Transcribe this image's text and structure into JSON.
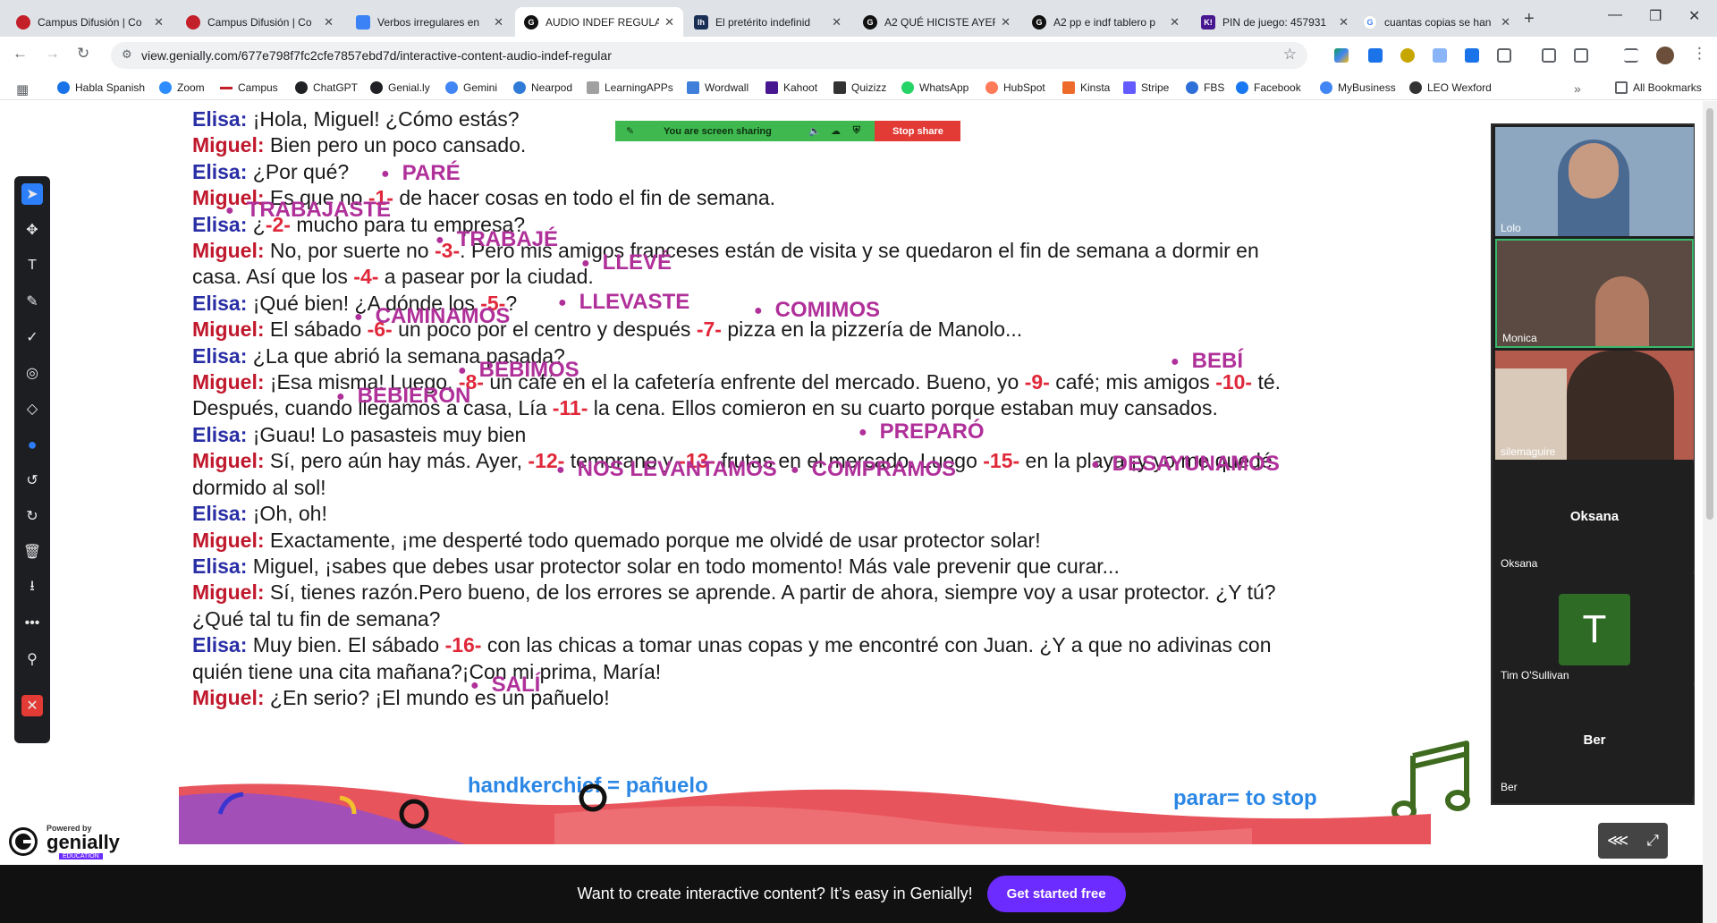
{
  "tabs": [
    {
      "title": "Campus Difusión | Co",
      "fav_color": "#c4202a",
      "fav_text": ""
    },
    {
      "title": "Campus Difusión | Co",
      "fav_color": "#c4202a",
      "fav_text": ""
    },
    {
      "title": "Verbos irregulares en",
      "fav_color": "#3b82f6",
      "fav_text": ""
    },
    {
      "title": "AUDIO INDEF REGULA",
      "fav_color": "#111111",
      "fav_text": "G"
    },
    {
      "title": "El pretérito indefinid",
      "fav_color": "#1a2f55",
      "fav_text": "lh"
    },
    {
      "title": "A2 QUÉ HICISTE AYER",
      "fav_color": "#111111",
      "fav_text": "G"
    },
    {
      "title": "A2 pp e indf tablero p",
      "fav_color": "#111111",
      "fav_text": "G"
    },
    {
      "title": "PIN de juego: 457931",
      "fav_color": "#46178f",
      "fav_text": "K!"
    },
    {
      "title": "cuantas copias se han",
      "fav_color": "#ffffff",
      "fav_text": "G"
    }
  ],
  "url": "view.genially.com/677e798f7fc2cfe7857ebd7d/interactive-content-audio-indef-regular",
  "bookmarks": [
    {
      "label": "Habla Spanish",
      "color": "#1a73e8"
    },
    {
      "label": "Zoom",
      "color": "#2d8cff"
    },
    {
      "label": "Campus",
      "color": "#c4202a"
    },
    {
      "label": "ChatGPT",
      "color": "#202124"
    },
    {
      "label": "Genial.ly",
      "color": "#202124"
    },
    {
      "label": "Gemini",
      "color": "#4285f4"
    },
    {
      "label": "Nearpod",
      "color": "#2f7bd7"
    },
    {
      "label": "LearningAPPs",
      "color": "#a0a0a0"
    },
    {
      "label": "Wordwall",
      "color": "#3f7fd9"
    },
    {
      "label": "Kahoot",
      "color": "#46178f"
    },
    {
      "label": "Quizizz",
      "color": "#333333"
    },
    {
      "label": "WhatsApp",
      "color": "#25d366"
    },
    {
      "label": "HubSpot",
      "color": "#ff7a59"
    },
    {
      "label": "Kinsta",
      "color": "#ee6a2b"
    },
    {
      "label": "Stripe",
      "color": "#635bff"
    },
    {
      "label": "FBS",
      "color": "#2e6fd8"
    },
    {
      "label": "Facebook",
      "color": "#1877f2"
    },
    {
      "label": "MyBusiness",
      "color": "#4285f4"
    },
    {
      "label": "LEO Wexford",
      "color": "#333333"
    }
  ],
  "all_bookmarks": "All Bookmarks",
  "screen_share": {
    "status": "You are screen sharing",
    "stop": "Stop share"
  },
  "dialogue": [
    [
      {
        "t": "spk",
        "c": "elisa",
        "v": "Elisa:"
      },
      {
        "t": "txt",
        "v": " ¡Hola, Miguel! ¿Cómo estás?"
      }
    ],
    [
      {
        "t": "spk",
        "c": "miguel",
        "v": "Miguel:"
      },
      {
        "t": "txt",
        "v": " Bien pero un poco cansado."
      }
    ],
    [
      {
        "t": "spk",
        "c": "elisa",
        "v": "Elisa:"
      },
      {
        "t": "txt",
        "v": " ¿Por qué?"
      }
    ],
    [
      {
        "t": "spk",
        "c": "miguel",
        "v": "Miguel:"
      },
      {
        "t": "txt",
        "v": " Es que no "
      },
      {
        "t": "gap",
        "v": "-1-"
      },
      {
        "t": "txt",
        "v": " de hacer cosas en todo el fin de semana."
      }
    ],
    [
      {
        "t": "spk",
        "c": "elisa",
        "v": "Elisa:"
      },
      {
        "t": "txt",
        "v": " ¿"
      },
      {
        "t": "gap",
        "v": "-2-"
      },
      {
        "t": "txt",
        "v": " mucho para tu empresa?"
      }
    ],
    [
      {
        "t": "spk",
        "c": "miguel",
        "v": "Miguel:"
      },
      {
        "t": "txt",
        "v": " No, por suerte no "
      },
      {
        "t": "gap",
        "v": "-3-"
      },
      {
        "t": "txt",
        "v": ". Pero mis amigos franceses están de visita y se quedaron el fin de semana a dormir en casa. Así que los "
      },
      {
        "t": "gap",
        "v": "-4-"
      },
      {
        "t": "txt",
        "v": " a pasear por la ciudad."
      }
    ],
    [
      {
        "t": "spk",
        "c": "elisa",
        "v": "Elisa:"
      },
      {
        "t": "txt",
        "v": " ¡Qué bien! ¿A dónde los "
      },
      {
        "t": "gap",
        "v": "-5-"
      },
      {
        "t": "txt",
        "v": "?"
      }
    ],
    [
      {
        "t": "spk",
        "c": "miguel",
        "v": "Miguel:"
      },
      {
        "t": "txt",
        "v": " El sábado "
      },
      {
        "t": "gap",
        "v": "-6-"
      },
      {
        "t": "txt",
        "v": " un poco por el centro y después "
      },
      {
        "t": "gap",
        "v": "-7-"
      },
      {
        "t": "txt",
        "v": " pizza en la pizzería de Manolo..."
      }
    ],
    [
      {
        "t": "spk",
        "c": "elisa",
        "v": "Elisa:"
      },
      {
        "t": "txt",
        "v": " ¿La que abrió la semana pasada?"
      }
    ],
    [
      {
        "t": "spk",
        "c": "miguel",
        "v": "Miguel:"
      },
      {
        "t": "txt",
        "v": " ¡Esa misma! Luego, "
      },
      {
        "t": "gap",
        "v": "-8-"
      },
      {
        "t": "txt",
        "v": " un café en el la cafetería enfrente del mercado. Bueno, yo "
      },
      {
        "t": "gap",
        "v": "-9-"
      },
      {
        "t": "txt",
        "v": " café; mis amigos "
      },
      {
        "t": "gap",
        "v": "-10-"
      },
      {
        "t": "txt",
        "v": " té. Después, cuando llegamos a casa, Lía "
      },
      {
        "t": "gap",
        "v": "-11-"
      },
      {
        "t": "txt",
        "v": " la cena. Ellos comieron en su cuarto porque estaban muy cansados."
      }
    ],
    [
      {
        "t": "spk",
        "c": "elisa",
        "v": "Elisa:"
      },
      {
        "t": "txt",
        "v": " ¡Guau! Lo pasasteis muy bien"
      }
    ],
    [
      {
        "t": "spk",
        "c": "miguel",
        "v": "Miguel:"
      },
      {
        "t": "txt",
        "v": " Sí, pero aún hay más. Ayer, "
      },
      {
        "t": "gap",
        "v": "-12-"
      },
      {
        "t": "txt",
        "v": " temprano y "
      },
      {
        "t": "gap",
        "v": "-13-"
      },
      {
        "t": "txt",
        "v": "  frutas en el mercado. Luego "
      },
      {
        "t": "gap",
        "v": "-15-"
      },
      {
        "t": "txt",
        "v": " en la playa ¡y yo me quedé dormido al sol!"
      }
    ],
    [
      {
        "t": "spk",
        "c": "elisa",
        "v": "Elisa:"
      },
      {
        "t": "txt",
        "v": " ¡Oh, oh!"
      }
    ],
    [
      {
        "t": "spk",
        "c": "miguel",
        "v": "Miguel:"
      },
      {
        "t": "txt",
        "v": " Exactamente, ¡me desperté todo quemado porque me olvidé de usar protector solar!"
      }
    ],
    [
      {
        "t": "spk",
        "c": "elisa",
        "v": "Elisa:"
      },
      {
        "t": "txt",
        "v": " Miguel, ¡sabes que debes usar protector solar en todo momento! Más vale prevenir que curar..."
      }
    ],
    [
      {
        "t": "spk",
        "c": "miguel",
        "v": "Miguel:"
      },
      {
        "t": "txt",
        "v": " Sí, tienes razón.Pero bueno, de los errores se aprende. A partir de ahora, siempre voy a usar protector. ¿Y tú? ¿Qué tal tu fin de semana?"
      }
    ],
    [
      {
        "t": "spk",
        "c": "elisa",
        "v": "Elisa:"
      },
      {
        "t": "txt",
        "v": " Muy bien. El sábado "
      },
      {
        "t": "gap",
        "v": "-16-"
      },
      {
        "t": "txt",
        "v": " con las chicas a tomar unas copas y me encontré con Juan. ¿Y a que no adivinas con quién tiene una cita mañana?¡Con mi prima, María!"
      }
    ],
    [
      {
        "t": "spk",
        "c": "miguel",
        "v": "Miguel:"
      },
      {
        "t": "txt",
        "v": " ¿En serio? ¡El mundo es un pañuelo!"
      }
    ]
  ],
  "words": {
    "pare": "PARÉ",
    "trabajaste": "TRABAJASTE",
    "trabaje": "TRABAJÉ",
    "lleve": "LLEVÉ",
    "llevaste": "LLEVASTE",
    "comimos": "COMIMOS",
    "caminamos": "CAMINAMOS",
    "bebi": "BEBÍ",
    "bebimos": "BEBIMOS",
    "bebieron": "BEBIERON",
    "preparo": "PREPARÓ",
    "nos_levantamos": "NOS LEVANTAMOS",
    "compramos": "COMPRAMOS",
    "desayunamos": "DESAYUNAMOS",
    "sali": "SALÍ"
  },
  "notes": {
    "handkerchief": "handkerchief = pañuelo",
    "parar": "parar= to stop"
  },
  "genially_logo": {
    "powered": "Powered by",
    "name": "genially",
    "edu": "EDUCATION"
  },
  "participants": [
    {
      "name": "Lolo",
      "video": true
    },
    {
      "name": "Monica",
      "video": true
    },
    {
      "name": "silemaguire",
      "video": true
    },
    {
      "name": "Oksana",
      "video": false,
      "center": "Oksana"
    },
    {
      "name": "Tim O'Sullivan",
      "video": false,
      "avatar": "T"
    },
    {
      "name": "Ber",
      "video": false,
      "center": "Ber"
    }
  ],
  "cta": {
    "text": "Want to create interactive content? It’s easy in Genially!",
    "button": "Get started free"
  }
}
